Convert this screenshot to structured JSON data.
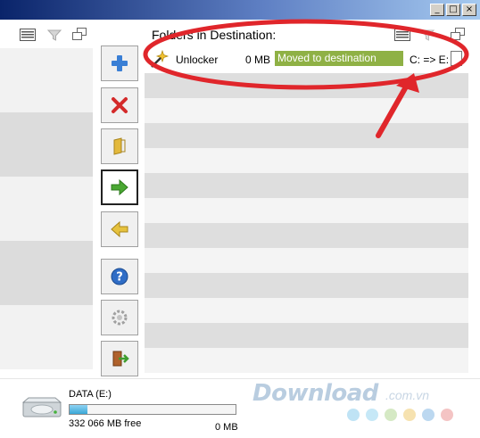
{
  "window": {
    "min_label": "_",
    "max_label": "□",
    "close_label": "×"
  },
  "right_panel": {
    "title": "Folders in Destination:"
  },
  "items": [
    {
      "name": "Unlocker",
      "size": "0 MB",
      "status": "Moved to destination",
      "path": "C: => E:"
    }
  ],
  "side_buttons": [
    {
      "icon": "add-icon"
    },
    {
      "icon": "delete-icon"
    },
    {
      "icon": "folder-icon"
    },
    {
      "icon": "move-right-arrow-icon"
    },
    {
      "icon": "move-left-arrow-icon"
    },
    {
      "icon": "help-icon"
    },
    {
      "icon": "settings-gear-icon"
    },
    {
      "icon": "exit-door-icon"
    }
  ],
  "drive": {
    "label": "DATA (E:)",
    "free": "332 066 MB free",
    "used": "0 MB",
    "used_fraction": 0.11
  },
  "watermark": {
    "brand": "Download",
    "suffix": ".com.vn"
  },
  "colors": {
    "status_green": "#8fb145",
    "annotation_red": "#e0262b",
    "drive_fill": "#3aa7d6",
    "titlebar": "#0a246a"
  }
}
